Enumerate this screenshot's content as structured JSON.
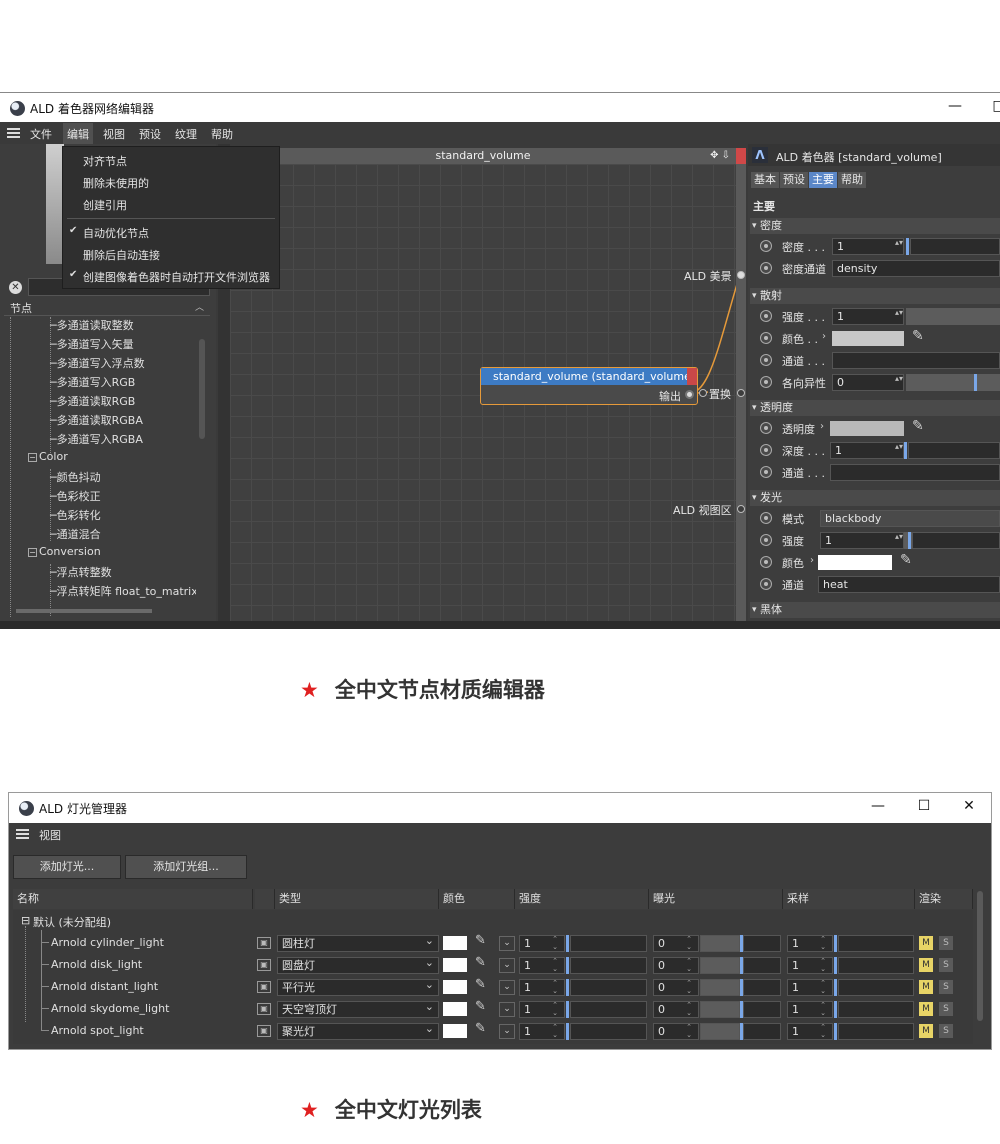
{
  "shader_editor": {
    "window_title": "ALD 着色器网络编辑器",
    "menu": [
      "文件",
      "编辑",
      "视图",
      "预设",
      "纹理",
      "帮助"
    ],
    "active_menu_index": 1,
    "edit_menu_items": [
      {
        "label": "对齐节点",
        "checked": false
      },
      {
        "label": "删除未使用的",
        "checked": false
      },
      {
        "label": "创建引用",
        "checked": false
      },
      {
        "label": "自动优化节点",
        "checked": true
      },
      {
        "label": "删除后自动连接",
        "checked": false
      },
      {
        "label": "创建图像着色器时自动打开文件浏览器",
        "checked": true
      }
    ],
    "tree_header": "节点",
    "tree_rows": [
      {
        "label": "多通道读取整数",
        "level": 2
      },
      {
        "label": "多通道写入矢量",
        "level": 2
      },
      {
        "label": "多通道写入浮点数",
        "level": 2
      },
      {
        "label": "多通道写入RGB",
        "level": 2
      },
      {
        "label": "多通道读取RGB",
        "level": 2
      },
      {
        "label": "多通道读取RGBA",
        "level": 2
      },
      {
        "label": "多通道写入RGBA",
        "level": 2
      },
      {
        "label": "Color",
        "level": 1,
        "expander": "−"
      },
      {
        "label": "颜色抖动",
        "level": 2
      },
      {
        "label": "色彩校正",
        "level": 2
      },
      {
        "label": "色彩转化",
        "level": 2
      },
      {
        "label": "通道混合",
        "level": 2
      },
      {
        "label": "Conversion",
        "level": 1,
        "expander": "−"
      },
      {
        "label": "浮点转整数",
        "level": 2
      },
      {
        "label": "浮点转矩阵 float_to_matrix",
        "level": 2
      }
    ],
    "graph_title": "standard_volume",
    "graph_ports": {
      "ald_beauty": "ALD 美景",
      "displacement": "置换",
      "ald_viewport": "ALD 视图区"
    },
    "node": {
      "title": "standard_volume (standard_volume)",
      "output_label": "输出"
    },
    "attr_panel": {
      "title": "ALD 着色器 [standard_volume]",
      "tabs": [
        "基本",
        "预设",
        "主要",
        "帮助"
      ],
      "active_tab_index": 2,
      "section": "主要",
      "groups": {
        "density": "密度",
        "scatter": "散射",
        "transparency": "透明度",
        "emission": "发光",
        "blackbody": "黑体"
      },
      "density_label": "密度 . . .",
      "density_value": "1",
      "density_channel_label": "密度通道",
      "density_channel_value": "density",
      "scatter_intensity_label": "强度 . . .",
      "scatter_intensity_value": "1",
      "scatter_color_label": "颜色 . .",
      "scatter_color": "#c8c8c8",
      "scatter_channel_label": "通道 . . .",
      "anisotropy_label": "各向异性",
      "anisotropy_value": "0",
      "transparency_label": "透明度",
      "transparency_color": "#b9b9b9",
      "depth_label": "深度 . . .",
      "depth_value": "1",
      "trans_channel_label": "通道 . . .",
      "mode_label": "模式",
      "mode_value": "blackbody",
      "emission_intensity_label": "强度",
      "emission_intensity_value": "1",
      "emission_color_label": "颜色",
      "emission_color": "#ffffff",
      "emission_channel_label": "通道",
      "emission_channel_value": "heat"
    }
  },
  "caption1": "全中文节点材质编辑器",
  "light_manager": {
    "window_title": "ALD 灯光管理器",
    "menu_view": "视图",
    "add_light_button": "添加灯光...",
    "add_group_button": "添加灯光组...",
    "columns": [
      "名称",
      "类型",
      "颜色",
      "强度",
      "曝光",
      "采样",
      "渲染"
    ],
    "group_label": "默认 (未分配组)",
    "lights": [
      {
        "name": "Arnold cylinder_light",
        "type": "圆柱灯",
        "intensity": "1",
        "exposure": "0",
        "samples": "1"
      },
      {
        "name": "Arnold disk_light",
        "type": "圆盘灯",
        "intensity": "1",
        "exposure": "0",
        "samples": "1"
      },
      {
        "name": "Arnold distant_light",
        "type": "平行光",
        "intensity": "1",
        "exposure": "0",
        "samples": "1"
      },
      {
        "name": "Arnold skydome_light",
        "type": "天空穹顶灯",
        "intensity": "1",
        "exposure": "0",
        "samples": "1"
      },
      {
        "name": "Arnold spot_light",
        "type": "聚光灯",
        "intensity": "1",
        "exposure": "0",
        "samples": "1"
      }
    ],
    "mute_label": "M",
    "solo_label": "S"
  },
  "caption2": "全中文灯光列表",
  "icons": {
    "star": "red-star-icon",
    "close": "close-icon",
    "maximize": "maximize-icon",
    "minimize": "minimize-icon"
  },
  "colors": {
    "accent_blue": "#3d7bc4",
    "node_border": "#e69a3a",
    "star_red": "#e02020",
    "mute_yellow": "#e8d466"
  }
}
